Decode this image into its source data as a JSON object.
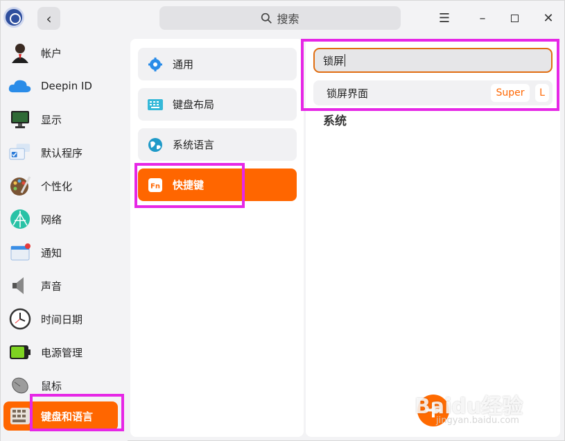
{
  "titlebar": {
    "back_glyph": "‹",
    "search_placeholder": "搜索",
    "menu_glyph": "☰",
    "min_glyph": "–",
    "close_glyph": "✕"
  },
  "sidebar": {
    "items": [
      {
        "label": "帐户",
        "icon": "account-icon",
        "active": false
      },
      {
        "label": "Deepin ID",
        "icon": "cloud-icon",
        "active": false
      },
      {
        "label": "显示",
        "icon": "display-icon",
        "active": false
      },
      {
        "label": "默认程序",
        "icon": "default-apps-icon",
        "active": false
      },
      {
        "label": "个性化",
        "icon": "palette-icon",
        "active": false
      },
      {
        "label": "网络",
        "icon": "network-icon",
        "active": false
      },
      {
        "label": "通知",
        "icon": "notification-icon",
        "active": false
      },
      {
        "label": "声音",
        "icon": "speaker-icon",
        "active": false
      },
      {
        "label": "时间日期",
        "icon": "clock-icon",
        "active": false
      },
      {
        "label": "电源管理",
        "icon": "battery-icon",
        "active": false
      },
      {
        "label": "鼠标",
        "icon": "mouse-icon",
        "active": false
      },
      {
        "label": "键盘和语言",
        "icon": "keyboard-icon",
        "active": true
      }
    ]
  },
  "middle": {
    "items": [
      {
        "label": "通用",
        "icon": "gear-icon"
      },
      {
        "label": "键盘布局",
        "icon": "keyboard-layout-icon"
      },
      {
        "label": "系统语言",
        "icon": "language-icon"
      },
      {
        "label": "快捷键",
        "icon": "fn-key-icon",
        "active": true
      }
    ]
  },
  "shortcuts": {
    "search_value": "锁屏",
    "result": {
      "label": "锁屏界面",
      "keys": [
        "Super",
        "L"
      ]
    },
    "section_title": "系统",
    "add_glyph": "+"
  },
  "watermark": {
    "main": "Baidu经验",
    "sub": "jingyan.baidu.com"
  },
  "colors": {
    "accent": "#ff6600",
    "highlight": "#e627e6",
    "input_border": "#e06d10"
  }
}
